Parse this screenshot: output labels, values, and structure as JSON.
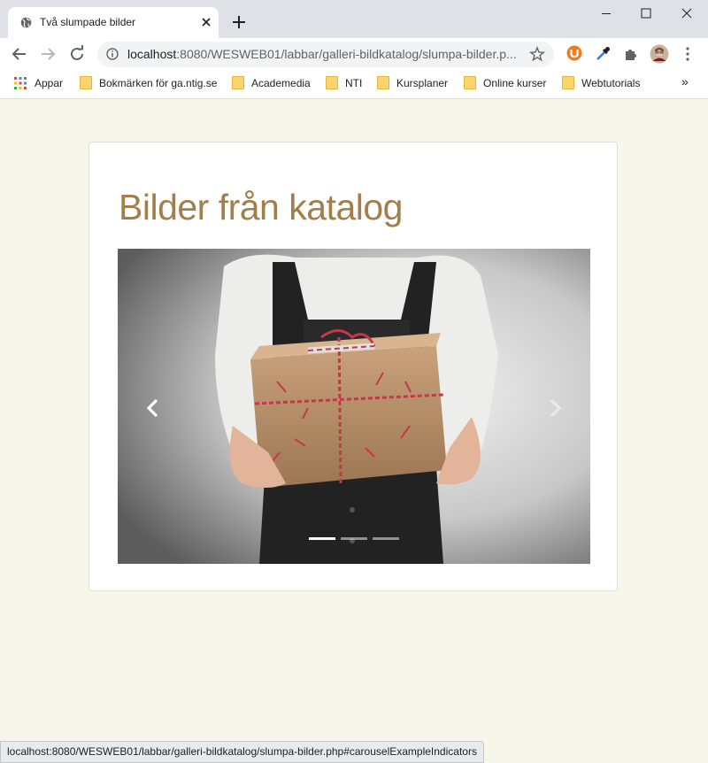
{
  "browser": {
    "tab_title": "Två slumpade bilder",
    "url_host": "localhost",
    "url_rest": ":8080/WESWEB01/labbar/galleri-bildkatalog/slumpa-bilder.p...",
    "bookmarks": [
      {
        "label": "Appar",
        "icon": "apps-grid-icon"
      },
      {
        "label": "Bokmärken för ga.ntig.se",
        "icon": "folder-icon"
      },
      {
        "label": "Academedia",
        "icon": "folder-icon"
      },
      {
        "label": "NTI",
        "icon": "folder-icon"
      },
      {
        "label": "Kursplaner",
        "icon": "folder-icon"
      },
      {
        "label": "Online kurser",
        "icon": "folder-icon"
      },
      {
        "label": "Webtutorials",
        "icon": "folder-icon"
      }
    ],
    "more_bookmarks": "»",
    "status_url": "localhost:8080/WESWEB01/labbar/galleri-bildkatalog/slumpa-bilder.php#carouselExampleIndicators"
  },
  "page": {
    "heading": "Bilder från katalog",
    "carousel": {
      "slide_count": 3,
      "active_index": 0,
      "image_subject": "person holding a gift wrapped in brown paper with red and white string",
      "prev_icon": "chevron-left-icon",
      "next_icon": "chevron-right-icon"
    }
  },
  "colors": {
    "page_bg": "#f8f5ea",
    "heading": "#a17e4a",
    "card_bg": "#ffffff"
  }
}
